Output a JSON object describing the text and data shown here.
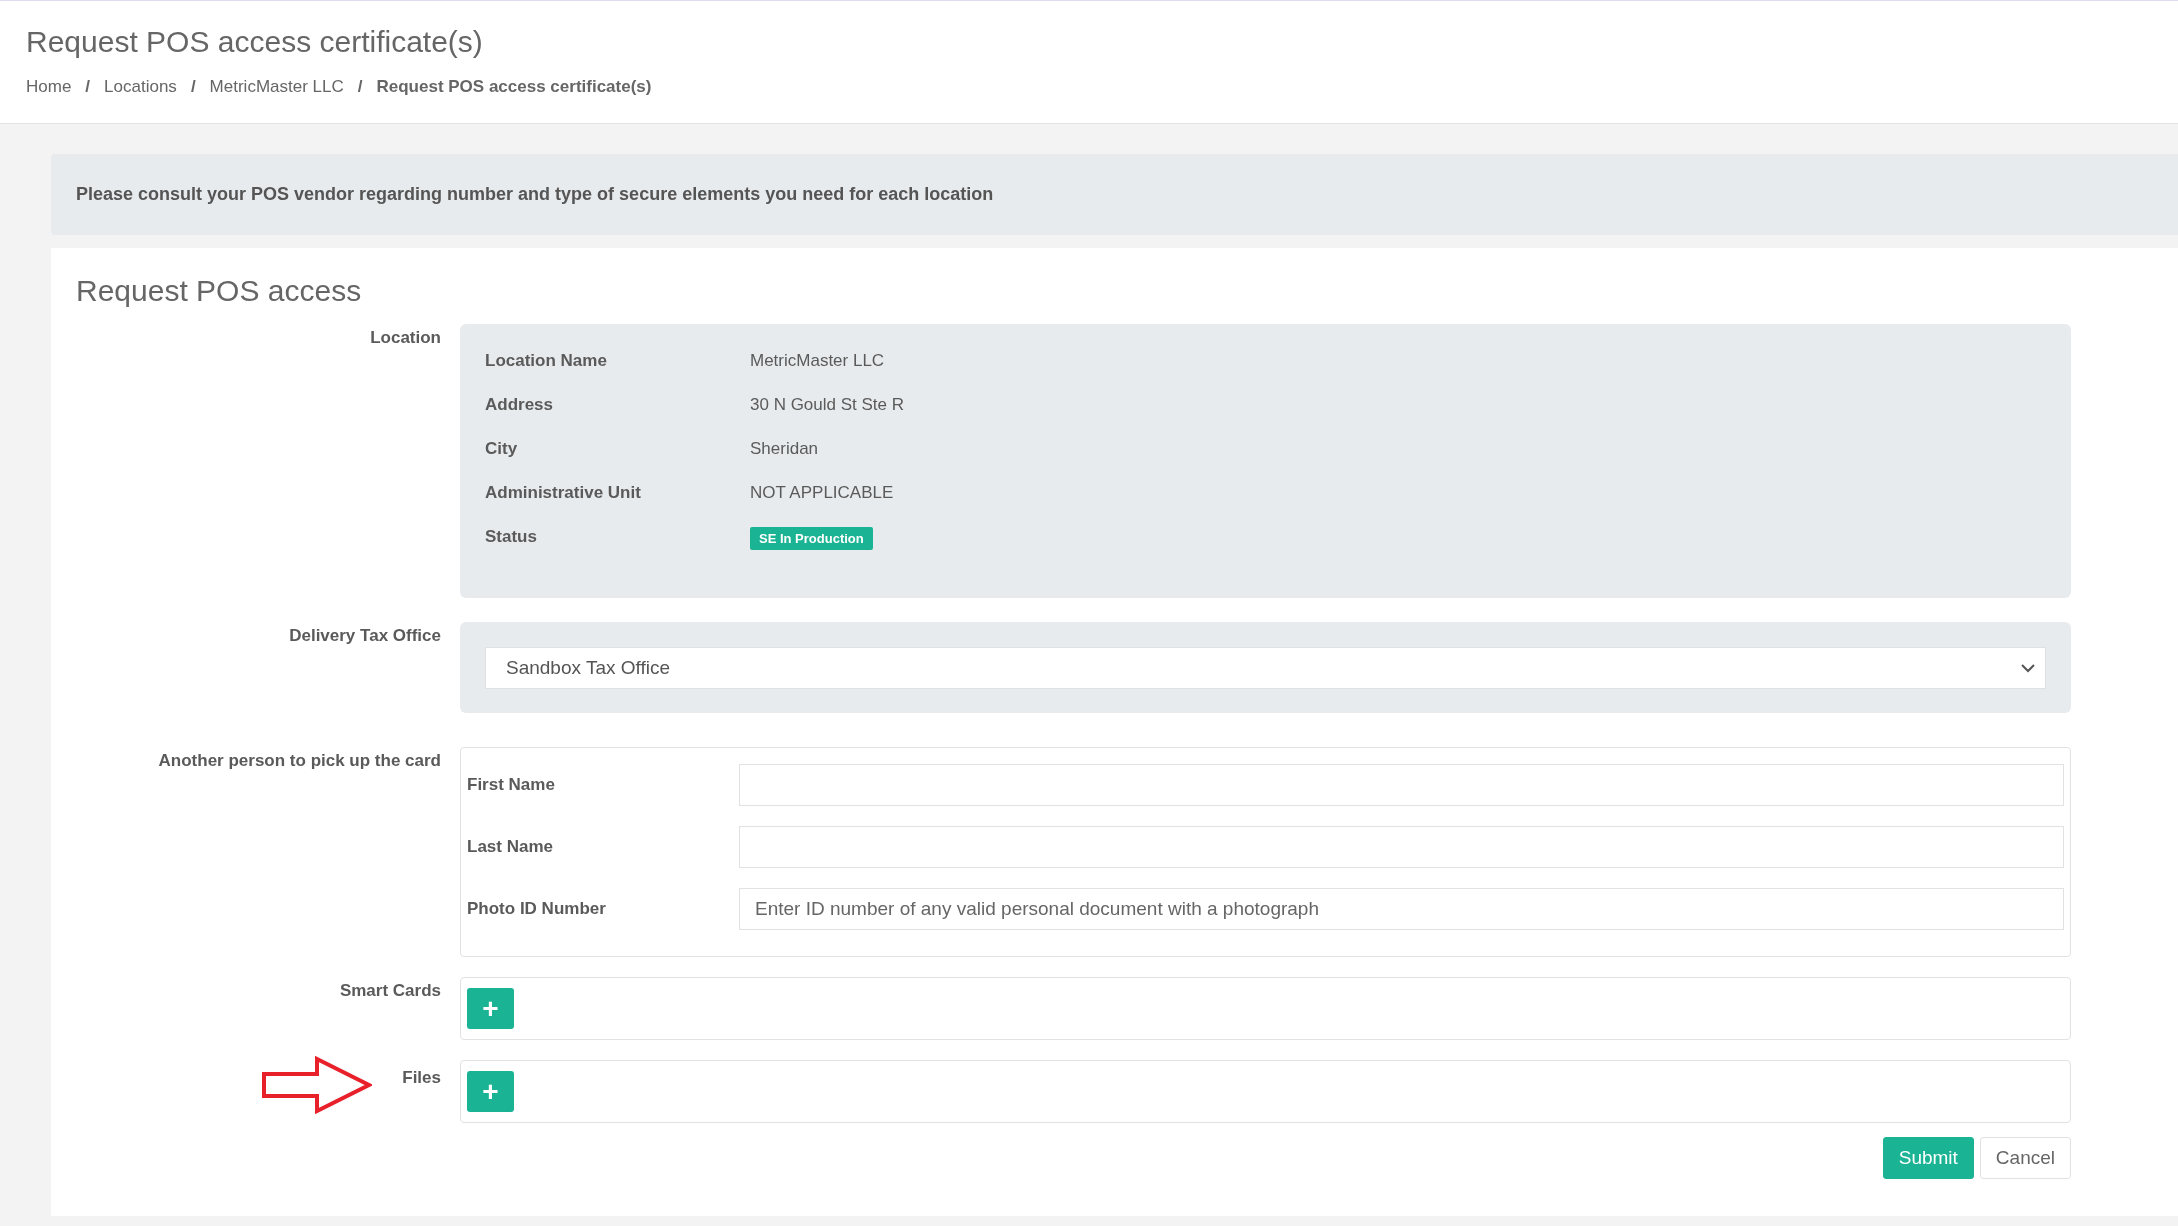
{
  "header": {
    "title": "Request POS access certificate(s)",
    "breadcrumb": [
      {
        "label": "Home",
        "current": false
      },
      {
        "label": "Locations",
        "current": false
      },
      {
        "label": "MetricMaster LLC",
        "current": false
      },
      {
        "label": "Request POS access certificate(s)",
        "current": true
      }
    ],
    "separator": "/"
  },
  "notice": "Please consult your POS vendor regarding number and type of secure elements you need for each location",
  "form": {
    "title": "Request POS access",
    "location": {
      "label": "Location",
      "rows": [
        {
          "label": "Location Name",
          "value": "MetricMaster LLC",
          "kind": "text"
        },
        {
          "label": "Address",
          "value": "30 N Gould St Ste R",
          "kind": "text"
        },
        {
          "label": "City",
          "value": "Sheridan",
          "kind": "text"
        },
        {
          "label": "Administrative Unit",
          "value": "NOT APPLICABLE",
          "kind": "text"
        },
        {
          "label": "Status",
          "value": "SE In Production",
          "kind": "badge"
        }
      ]
    },
    "delivery": {
      "label": "Delivery Tax Office",
      "value": "Sandbox Tax Office"
    },
    "person": {
      "label": "Another person to pick up the card",
      "fields": [
        {
          "label": "First Name"
        },
        {
          "label": "Last Name"
        },
        {
          "label": "Photo ID Number",
          "placeholder": "Enter ID number of any valid personal document with a photograph"
        }
      ]
    },
    "smart_cards": {
      "label": "Smart Cards",
      "button": "+"
    },
    "files": {
      "label": "Files",
      "button": "+",
      "annotated": true
    },
    "buttons": [
      {
        "label": "Submit",
        "kind": "primary"
      },
      {
        "label": "Cancel",
        "kind": "secondary"
      }
    ]
  }
}
